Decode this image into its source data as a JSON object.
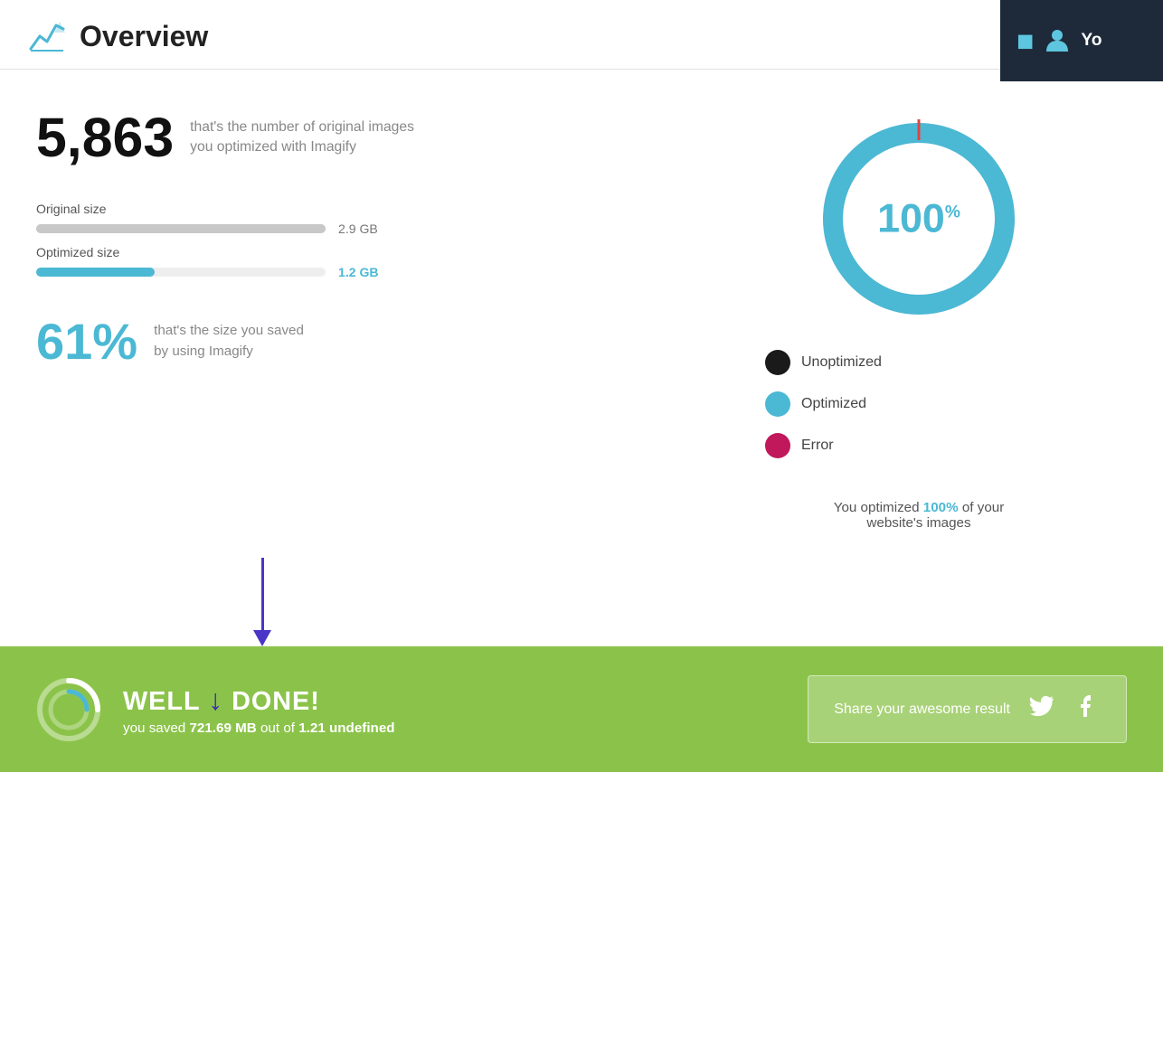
{
  "header": {
    "title": "Overview",
    "user_label": "Yo"
  },
  "stats": {
    "images_count": "5,863",
    "images_desc": "that's the number of original images\nyou optimized with Imagify",
    "original_size_label": "Original size",
    "original_size_value": "2.9 GB",
    "optimized_size_label": "Optimized size",
    "optimized_size_value": "1.2 GB",
    "savings_percent": "61%",
    "savings_desc": "that's the size you saved\nby using Imagify"
  },
  "donut": {
    "percent": "100",
    "percent_symbol": "%"
  },
  "legend": {
    "items": [
      {
        "label": "Unoptimized",
        "color": "#1a1a1a"
      },
      {
        "label": "Optimized",
        "color": "#4bb8d4"
      },
      {
        "label": "Error",
        "color": "#c0185a"
      }
    ]
  },
  "optimization_text_prefix": "You optimized ",
  "optimization_percent": "100%",
  "optimization_text_suffix": " of your\nwebsite's images",
  "banner": {
    "well_done": "WELL DONE!",
    "saved_text_prefix": "you saved ",
    "saved_amount": "721.69 MB",
    "saved_text_mid": " out of ",
    "saved_total": "1.21 undefined"
  },
  "share": {
    "text": "Share your awesome result"
  }
}
